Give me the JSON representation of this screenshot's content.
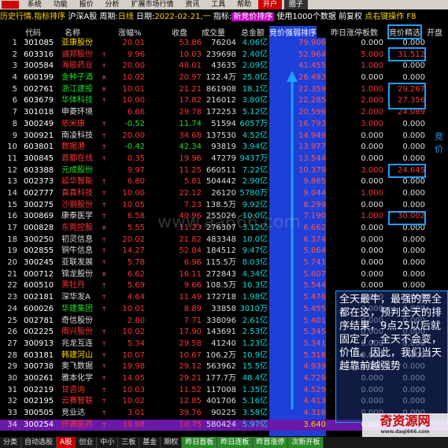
{
  "menu": [
    "系统",
    "功能",
    "报价",
    "分析",
    "扩展市场行情",
    "资讯",
    "工具",
    "帮助"
  ],
  "menu_kp": "开户",
  "menu_qz": "圈子",
  "info": {
    "t1": "历史行情.指标排序",
    "t2": "沪深A股",
    "t3": "周期:",
    "t4": "日线",
    "t5": "日期:",
    "t6": "2022-02-21,一",
    "t7": "指标:",
    "t8": "新竞价排序",
    "t9": "使用1000个数据 前复权",
    "t10": "点右键操作 F8"
  },
  "headers": {
    "code": "代码",
    "name": "名称",
    "pct": "涨幅%",
    "close": "收盘",
    "vol": "成交量",
    "amt": "总金额",
    "str": "竞价强弱排序",
    "yzt": "昨日涨停板数",
    "jj": "竞价精选",
    "kp": "开盘"
  },
  "rows": [
    {
      "no": "1",
      "code": "301085",
      "name": "亚康股份",
      "nc": "#ffd400",
      "mk": "",
      "pct": "20.01",
      "pc": "#ff3333",
      "close": "53.86",
      "cc": "#ff3333",
      "vol": "76204",
      "amt": "4.06亿",
      "str": "79.906",
      "yzt": "0.000",
      "jj": "0.000",
      "jc": "#ddd"
    },
    {
      "no": "2",
      "code": "603316",
      "name": "诚邦股份",
      "nc": "#ff3333",
      "mk": "T",
      "pct": "9.96",
      "pc": "#ff3333",
      "close": "10.03",
      "cc": "#ff3333",
      "vol": "239698",
      "amt": "2.40亿",
      "str": "52.964",
      "yzt": "5.000",
      "jj": "31.512",
      "jc": "#ff3333"
    },
    {
      "no": "3",
      "code": "300584",
      "name": "海辰药业",
      "nc": "#ff3333",
      "mk": "T",
      "pct": "20.00",
      "pc": "#ff3333",
      "close": "48.01",
      "cc": "#ff3333",
      "vol": "43635",
      "amt": "2.09亿",
      "str": "41.455",
      "yzt": "1.000",
      "jj": "0.000",
      "jc": "#ddd"
    },
    {
      "no": "4",
      "code": "600199",
      "name": "金种子酒",
      "nc": "#22dd22",
      "mk": "R",
      "pct": "10.02",
      "pc": "#ff3333",
      "close": "20.97",
      "cc": "#ff3333",
      "vol": "122.4万",
      "amt": "25.0亿",
      "str": "26.493",
      "yzt": "0.000",
      "jj": "0.000",
      "jc": "#ddd"
    },
    {
      "no": "5",
      "code": "002761",
      "name": "浙江建投",
      "nc": "#22dd22",
      "mk": "R",
      "pct": "10.01",
      "pc": "#ff3333",
      "close": "21.21",
      "cc": "#ff3333",
      "vol": "861908",
      "amt": "18.1亿",
      "str": "22.359",
      "yzt": "1.000",
      "jj": "29.267",
      "jc": "#ff3333"
    },
    {
      "no": "6",
      "code": "603679",
      "name": "华体科技",
      "nc": "#22dd22",
      "mk": "T",
      "pct": "10.00",
      "pc": "#ff3333",
      "close": "17.82",
      "cc": "#ff3333",
      "vol": "216012",
      "amt": "3.80亿",
      "str": "22.285",
      "yzt": "2.000",
      "jj": "27.356",
      "jc": "#ff3333"
    },
    {
      "no": "7",
      "code": "301018",
      "name": "申菱环境",
      "nc": "#ddd",
      "mk": "",
      "pct": "6.66",
      "pc": "#ff3333",
      "close": "29.78",
      "cc": "#ff3333",
      "vol": "172253",
      "amt": "5.12亿",
      "str": "20.599",
      "yzt": "2.000",
      "jj": "24.089",
      "jc": "#ff3333"
    },
    {
      "no": "8",
      "code": "300249",
      "name": "依米康",
      "nc": "#ff3333",
      "mk": "T",
      "pct": "-0.52",
      "pc": "#22dd22",
      "close": "11.74",
      "cc": "#22dd22",
      "vol": "51594",
      "amt": "6057万",
      "str": "16.793",
      "yzt": "3.000",
      "jj": "0.000",
      "jc": "#ddd"
    },
    {
      "no": "9",
      "code": "300921",
      "name": "南凌科技",
      "nc": "#ddd",
      "mk": "T",
      "pct": "20.00",
      "pc": "#ff3333",
      "close": "34.68",
      "cc": "#ff3333",
      "vol": "137530",
      "amt": "4.52亿",
      "str": "14.949",
      "yzt": "0.000",
      "jj": "0.000",
      "jc": "#ddd"
    },
    {
      "no": "10",
      "code": "603801",
      "name": "数据港",
      "nc": "#ff3333",
      "mk": "T",
      "pct": "-0.42",
      "pc": "#22dd22",
      "close": "42.34",
      "cc": "#22dd22",
      "vol": "93819",
      "amt": "3.94亿",
      "str": "13.977",
      "yzt": "0.000",
      "jj": "0.000",
      "jc": "#ddd"
    },
    {
      "no": "11",
      "code": "300845",
      "name": "首都在线",
      "nc": "#ff3333",
      "mk": "T",
      "pct": "0.35",
      "pc": "#ff3333",
      "close": "19.96",
      "cc": "#ff3333",
      "vol": "47279",
      "amt": "9437万",
      "str": "13.544",
      "yzt": "0.000",
      "jj": "0.000",
      "jc": "#ddd"
    },
    {
      "no": "12",
      "code": "603388",
      "name": "元成股份",
      "nc": "#22dd22",
      "mk": "",
      "pct": "9.97",
      "pc": "#ff3333",
      "close": "11.25",
      "cc": "#ff3333",
      "vol": "660511",
      "amt": "7.22亿",
      "str": "10.379",
      "yzt": "3.000",
      "jj": "24.645",
      "jc": "#ff3333"
    },
    {
      "no": "13",
      "code": "002373",
      "name": "延华智能",
      "nc": "#ff3333",
      "mk": "T",
      "pct": "6.80",
      "pc": "#ff3333",
      "close": "5.81",
      "cc": "#ff3333",
      "vol": "504442",
      "amt": "2.90亿",
      "str": "9.865",
      "yzt": "0.000",
      "jj": "0.000",
      "jc": "#ddd"
    },
    {
      "no": "14",
      "code": "002777",
      "name": "真真科技",
      "nc": "#ff3333",
      "mk": "T",
      "pct": "10.00",
      "pc": "#ff3333",
      "close": "22.12",
      "cc": "#ff3333",
      "vol": "26120",
      "amt": "5780万",
      "str": "9.044",
      "yzt": "1.000",
      "jj": "0.000",
      "jc": "#ddd"
    },
    {
      "no": "15",
      "code": "300275",
      "name": "沙钢股份",
      "nc": "#ff3333",
      "mk": "T",
      "pct": "10.05",
      "pc": "#ff3333",
      "close": "7.23",
      "cc": "#ff3333",
      "vol": "138.5万",
      "amt": "9.92亿",
      "str": "8.299",
      "yzt": "0.000",
      "jj": "0.000",
      "jc": "#ddd"
    },
    {
      "no": "16",
      "code": "300869",
      "name": "康泰医学",
      "nc": "#ddd",
      "mk": "T",
      "pct": "6.58",
      "pc": "#ff3333",
      "close": "40.96",
      "cc": "#ff3333",
      "vol": "255026",
      "amt": "10.0亿",
      "str": "7.190",
      "yzt": "1.000",
      "jj": "30.002",
      "jc": "#ff3333"
    },
    {
      "no": "17",
      "code": "000828",
      "name": "东莞控股",
      "nc": "#ff3333",
      "mk": "R",
      "pct": "5.55",
      "pc": "#ff3333",
      "close": "11.23",
      "cc": "#ff3333",
      "vol": "276307",
      "amt": "3.12亿",
      "str": "6.662",
      "yzt": "0.000",
      "jj": "0.000",
      "jc": "#ddd"
    },
    {
      "no": "18",
      "code": "300250",
      "name": "初灵信息",
      "nc": "#ddd",
      "mk": "T",
      "pct": "20.02",
      "pc": "#ff3333",
      "close": "21.82",
      "cc": "#ff3333",
      "vol": "483348",
      "amt": "10.0亿",
      "str": "6.374",
      "yzt": "0.000",
      "jj": "0.000",
      "jc": "#ddd"
    },
    {
      "no": "19",
      "code": "002855",
      "name": "铜牛信息",
      "nc": "#ddd",
      "mk": "T",
      "pct": "14.27",
      "pc": "#ff3333",
      "close": "52.84",
      "cc": "#ff3333",
      "vol": "184512",
      "amt": "9.47亿",
      "str": "5.864",
      "yzt": "0.000",
      "jj": "0.000",
      "jc": "#ddd"
    },
    {
      "no": "20",
      "code": "300245",
      "name": "亚联发展",
      "nc": "#ddd",
      "mk": "T",
      "pct": "5.78",
      "pc": "#ff3333",
      "close": "6.96",
      "cc": "#ff3333",
      "vol": "115.5万",
      "amt": "8.03亿",
      "str": "5.741",
      "yzt": "0.000",
      "jj": "0.000",
      "jc": "#ddd"
    },
    {
      "no": "21",
      "code": "000712",
      "name": "锦龙股份",
      "nc": "#ddd",
      "mk": "R",
      "pct": "6.62",
      "pc": "#ff3333",
      "close": "16.11",
      "cc": "#ff3333",
      "vol": "272843",
      "amt": "4.34亿",
      "str": "5.607",
      "yzt": "0.000",
      "jj": "0.000",
      "jc": "#ddd"
    },
    {
      "no": "22",
      "code": "600510",
      "name": "黑牡丹",
      "nc": "#ff3333",
      "mk": "T",
      "pct": "5.69",
      "pc": "#ff3333",
      "close": "9.66",
      "cc": "#ff3333",
      "vol": "108.5万",
      "amt": "10.3亿",
      "str": "5.544",
      "yzt": "0.000",
      "jj": "0.000",
      "jc": "#ddd"
    },
    {
      "no": "23",
      "code": "002181",
      "name": "深华发A",
      "nc": "#ddd",
      "mk": "T",
      "pct": "4.64",
      "pc": "#ff3333",
      "close": "11.49",
      "cc": "#ff3333",
      "vol": "172718",
      "amt": "1.98亿",
      "str": "5.476",
      "yzt": "0.000",
      "jj": "0.000",
      "jc": "#ddd"
    },
    {
      "no": "24",
      "code": "600026",
      "name": "华建集团",
      "nc": "#22dd22",
      "mk": "T",
      "pct": "10.01",
      "pc": "#ff3333",
      "close": "8.89",
      "cc": "#ff3333",
      "vol": "33858",
      "amt": "3010万",
      "str": "5.455",
      "yzt": "0.000",
      "jj": "0.000",
      "jc": "#ddd"
    },
    {
      "no": "25",
      "code": "002781",
      "name": "奇信股份",
      "nc": "#ddd",
      "mk": "",
      "pct": "2.80",
      "pc": "#ff3333",
      "close": "7.71",
      "cc": "#ff3333",
      "vol": "338096",
      "amt": "2.61亿",
      "str": "5.401",
      "yzt": "0.000",
      "jj": "0.000",
      "jc": "#ddd"
    },
    {
      "no": "26",
      "code": "002225",
      "name": "南兴股份",
      "nc": "#ff3333",
      "mk": "T",
      "pct": "10.02",
      "pc": "#ff3333",
      "close": "17.90",
      "cc": "#ff3333",
      "vol": "143691",
      "amt": "2.53亿",
      "str": "5.345",
      "yzt": "0.000",
      "jj": "0.000",
      "jc": "#ddd"
    },
    {
      "no": "27",
      "code": "300913",
      "name": "兆龙互连",
      "nc": "#ddd",
      "mk": "T",
      "pct": "5.34",
      "pc": "#ff3333",
      "close": "29.58",
      "cc": "#ff3333",
      "vol": "41240",
      "amt": "1.23亿",
      "str": "5.341",
      "yzt": "0.000",
      "jj": "0.000",
      "jc": "#ddd"
    },
    {
      "no": "28",
      "code": "603181",
      "name": "韩建河山",
      "nc": "#ffd400",
      "mk": "T",
      "pct": "10.07",
      "pc": "#ff3333",
      "close": "10.67",
      "cc": "#ff3333",
      "vol": "106.2万",
      "amt": "10.9亿",
      "str": "5.318",
      "yzt": "0.000",
      "jj": "0.000",
      "jc": "#ddd"
    },
    {
      "no": "29",
      "code": "300738",
      "name": "奥飞数据",
      "nc": "#ddd",
      "mk": "T",
      "pct": "19.98",
      "pc": "#ff3333",
      "close": "29.12",
      "cc": "#ff3333",
      "vol": "563962",
      "amt": "15.5亿",
      "str": "4.939",
      "yzt": "0.000",
      "jj": "0.000",
      "jc": "#ddd"
    },
    {
      "no": "30",
      "code": "300261",
      "name": "雅本化学",
      "nc": "#ddd",
      "mk": "T",
      "pct": "14.05",
      "pc": "#ff3333",
      "close": "29.21",
      "cc": "#ff3333",
      "vol": "177.7万",
      "amt": "48.4亿",
      "str": "4.729",
      "yzt": "0.000",
      "jj": "0.000",
      "jc": "#ddd"
    },
    {
      "no": "31",
      "code": "002219",
      "name": "甘咨询",
      "nc": "#ff3333",
      "mk": "T",
      "pct": "10.03",
      "pc": "#ff3333",
      "close": "11.52",
      "cc": "#ff3333",
      "vol": "117008",
      "amt": "1.35亿",
      "str": "4.529",
      "yzt": "0.000",
      "jj": "0.000",
      "jc": "#ddd"
    },
    {
      "no": "32",
      "code": "002195",
      "name": "云赛智联",
      "nc": "#ff3333",
      "mk": "T",
      "pct": "10.02",
      "pc": "#ff3333",
      "close": "12.85",
      "cc": "#ff3333",
      "vol": "401706",
      "amt": "5.16亿",
      "str": "4.413",
      "yzt": "0.000",
      "jj": "0.000",
      "jc": "#ddd"
    },
    {
      "no": "33",
      "code": "300505",
      "name": "竞业达",
      "nc": "#ddd",
      "mk": "T",
      "pct": "3.01",
      "pc": "#ff3333",
      "close": "39.76",
      "cc": "#ff3333",
      "vol": "90225",
      "amt": "3.58亿",
      "str": "4.316",
      "yzt": "0.000",
      "jj": "0.000",
      "jc": "#ddd"
    },
    {
      "no": "34",
      "code": "300254",
      "name": "仟源医药",
      "nc": "#ff3333",
      "mk": "T",
      "pct": "19.98",
      "pc": "#ff3333",
      "close": "10.75",
      "cc": "#ff3333",
      "vol": "580424",
      "amt": "5.97亿",
      "str": "3.640",
      "yzt": "0.000",
      "jj": "0.000",
      "jc": "#ddd"
    }
  ],
  "annotation": "全天最牛，最强的票全都在这，预判全天的排序结果，9点25以后就固定了，全天不会变，价值。因此，我们当天越靠前越强势",
  "side_text": "竞价",
  "watermark": "www.aa666.com",
  "site_name": "奇资源网",
  "site_url": "www.daqi666.com",
  "tabs": [
    "分类",
    "自动选股",
    "A股",
    "创业",
    "中小",
    "三板",
    "基金",
    "期权",
    "昨日首板",
    "昨日连板",
    "昨首涨停",
    "次新开板"
  ],
  "tab_active": 2
}
